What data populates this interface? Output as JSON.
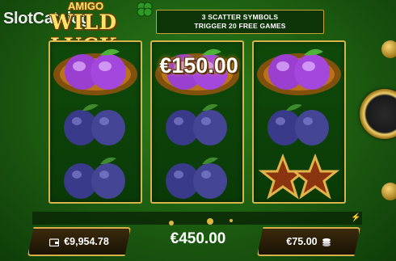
{
  "watermark": {
    "text": "Slot",
    "text2": "Catalog",
    "small": "®"
  },
  "logo": {
    "top_text": "AMIGO",
    "main_text": "WILD LUCK"
  },
  "banner": {
    "line1": "3 SCATTER SYMBOLS",
    "line2": "TRIGGER 20 FREE GAMES"
  },
  "reels": [
    {
      "symbols": [
        "plum-fire",
        "plum",
        "plum"
      ]
    },
    {
      "symbols": [
        "plum-fire",
        "plum",
        "plum"
      ]
    },
    {
      "symbols": [
        "plum-fire",
        "plum",
        "star"
      ]
    }
  ],
  "win_overlay": {
    "amount": "€150.00"
  },
  "bottom": {
    "balance": "€9,954.78",
    "total_win": "€450.00",
    "bet": "€75.00"
  },
  "icons": {
    "wallet": "wallet-icon",
    "coins": "coins-icon",
    "lightning": "lightning-icon",
    "spin": "spin-icon",
    "settings": "gear-icon"
  },
  "colors": {
    "reel_border": "#d6b54a",
    "background": "#1f6212",
    "text": "#ffffff"
  }
}
